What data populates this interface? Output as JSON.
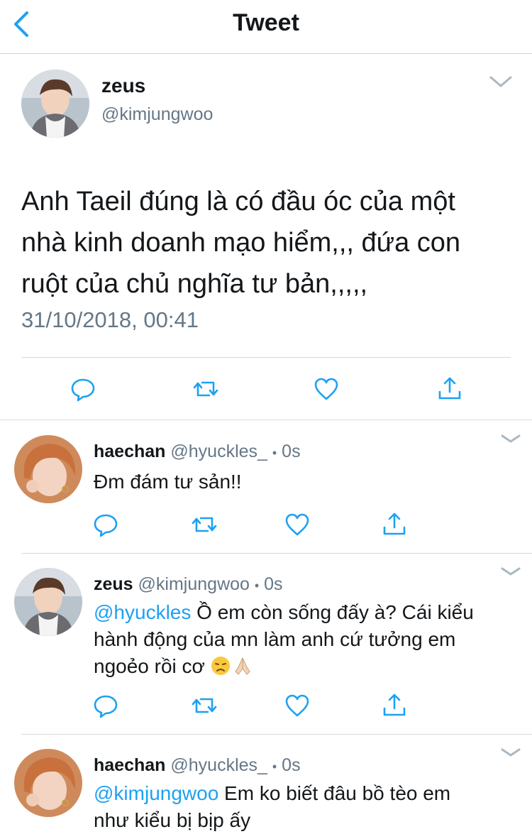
{
  "header": {
    "title": "Tweet"
  },
  "main_tweet": {
    "name": "zeus",
    "handle": "@kimjungwoo",
    "text_lines": [
      "Anh Taeil đúng là có đầu óc của một",
      "nhà kinh doanh mạo hiểm,,, đứa con",
      "ruột của chủ nghĩa tư bản,,,,,"
    ],
    "timestamp": "31/10/2018, 00:41"
  },
  "replies": [
    {
      "name": "haechan",
      "handle": "@hyuckles_",
      "dot": "•",
      "time": "0s",
      "mention": "",
      "text_lines": [
        "Đm đám tư sản!!"
      ]
    },
    {
      "name": "zeus",
      "handle": "@kimjungwoo",
      "dot": "•",
      "time": "0s",
      "mention": "@hyuckles",
      "text_lines": [
        " Ồ em còn sống đấy à? Cái kiểu",
        "hành động của mn làm anh cứ tưởng em",
        "ngoẻo rồi cơ "
      ]
    },
    {
      "name": "haechan",
      "handle": "@hyuckles_",
      "dot": "•",
      "time": "0s",
      "mention": "@kimjungwoo",
      "text_lines": [
        " Em ko biết đâu bồ tèo em",
        "như kiểu bị bịp ấy"
      ]
    }
  ],
  "icons": [
    "back-chevron-icon",
    "chevron-down-icon",
    "reply-icon",
    "retweet-icon",
    "like-icon",
    "share-icon",
    "disappointed-emoji-icon",
    "praying-hands-emoji-icon"
  ],
  "colors": {
    "accent": "#1da1f2",
    "secondary_text": "#657786",
    "icon": "#1da1f2"
  }
}
